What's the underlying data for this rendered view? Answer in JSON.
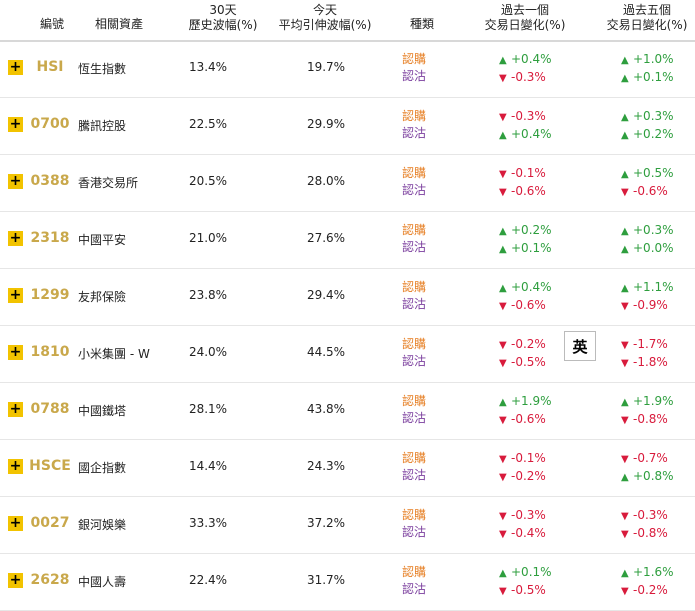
{
  "headers": {
    "code": "編號",
    "asset": "相關資產",
    "hv_top": "30天",
    "hv_bottom": "歷史波幅(%)",
    "iv_top": "今天",
    "iv_bottom": "平均引伸波幅(%)",
    "type": "種類",
    "d1_top": "過去一個",
    "d1_bottom": "交易日變化(%)",
    "d5_top": "過去五個",
    "d5_bottom": "交易日變化(%)"
  },
  "type_labels": {
    "call": "認購",
    "put": "認沽"
  },
  "lang_button": "英",
  "colors": {
    "expand_button": "#f2c300",
    "code": "#c9a84b",
    "up": "#2e9e3e",
    "down": "#d81b3c",
    "call": "#e67e22",
    "put": "#7b3f9e"
  },
  "rows": [
    {
      "code": "HSI",
      "name": "恆生指數",
      "hv": "13.4%",
      "iv": "19.7%",
      "d1_call": "+0.4%",
      "d1_put": "-0.3%",
      "d5_call": "+1.0%",
      "d5_put": "+0.1%"
    },
    {
      "code": "0700",
      "name": "騰訊控股",
      "hv": "22.5%",
      "iv": "29.9%",
      "d1_call": "-0.3%",
      "d1_put": "+0.4%",
      "d5_call": "+0.3%",
      "d5_put": "+0.2%"
    },
    {
      "code": "0388",
      "name": "香港交易所",
      "hv": "20.5%",
      "iv": "28.0%",
      "d1_call": "-0.1%",
      "d1_put": "-0.6%",
      "d5_call": "+0.5%",
      "d5_put": "-0.6%"
    },
    {
      "code": "2318",
      "name": "中國平安",
      "hv": "21.0%",
      "iv": "27.6%",
      "d1_call": "+0.2%",
      "d1_put": "+0.1%",
      "d5_call": "+0.3%",
      "d5_put": "+0.0%"
    },
    {
      "code": "1299",
      "name": "友邦保險",
      "hv": "23.8%",
      "iv": "29.4%",
      "d1_call": "+0.4%",
      "d1_put": "-0.6%",
      "d5_call": "+1.1%",
      "d5_put": "-0.9%"
    },
    {
      "code": "1810",
      "name": "小米集團 - W",
      "hv": "24.0%",
      "iv": "44.5%",
      "d1_call": "-0.2%",
      "d1_put": "-0.5%",
      "d5_call": "-1.7%",
      "d5_put": "-1.8%"
    },
    {
      "code": "0788",
      "name": "中國鐵塔",
      "hv": "28.1%",
      "iv": "43.8%",
      "d1_call": "+1.9%",
      "d1_put": "-0.6%",
      "d5_call": "+1.9%",
      "d5_put": "-0.8%"
    },
    {
      "code": "HSCE",
      "name": "國企指數",
      "hv": "14.4%",
      "iv": "24.3%",
      "d1_call": "-0.1%",
      "d1_put": "-0.2%",
      "d5_call": "-0.7%",
      "d5_put": "+0.8%"
    },
    {
      "code": "0027",
      "name": "銀河娛樂",
      "hv": "33.3%",
      "iv": "37.2%",
      "d1_call": "-0.3%",
      "d1_put": "-0.4%",
      "d5_call": "-0.3%",
      "d5_put": "-0.8%"
    },
    {
      "code": "2628",
      "name": "中國人壽",
      "hv": "22.4%",
      "iv": "31.7%",
      "d1_call": "+0.1%",
      "d1_put": "-0.5%",
      "d5_call": "+1.6%",
      "d5_put": "-0.2%"
    }
  ]
}
